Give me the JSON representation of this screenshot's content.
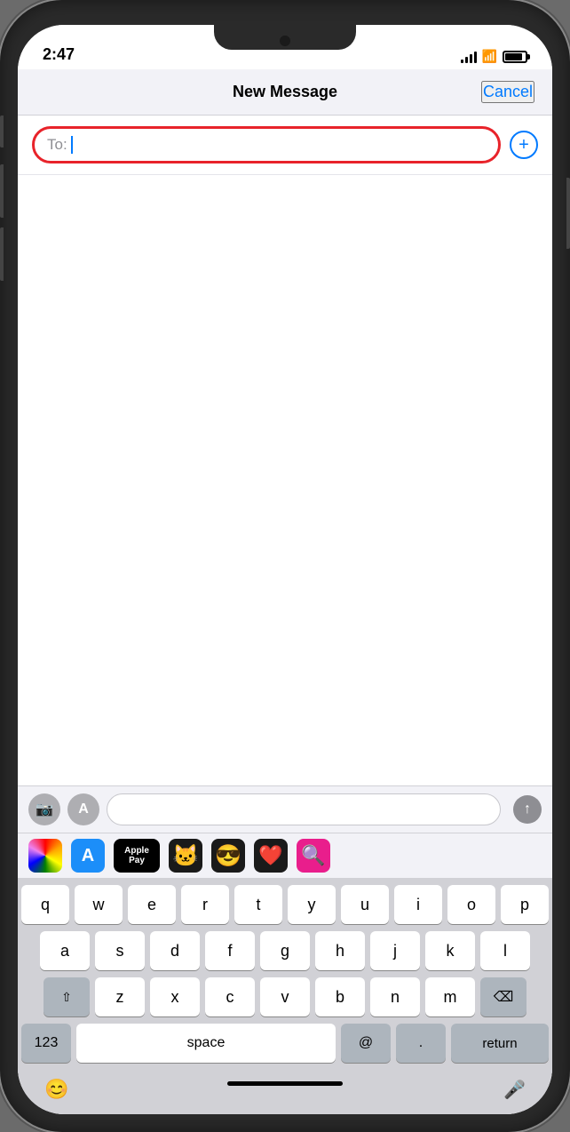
{
  "status": {
    "time": "2:47",
    "signal_bars": [
      4,
      7,
      10,
      13
    ],
    "battery_level": "80%"
  },
  "nav": {
    "title": "New Message",
    "cancel_label": "Cancel"
  },
  "to_field": {
    "label": "To:",
    "placeholder": ""
  },
  "app_strip": {
    "icons": [
      {
        "name": "photos",
        "emoji": "🌸",
        "bg": "#fff",
        "border": "1px solid #ddd"
      },
      {
        "name": "appstore",
        "emoji": "🅐",
        "bg": "#1c8ef9",
        "border": "none"
      },
      {
        "name": "applepay",
        "label": "Apple Pay",
        "bg": "#000",
        "border": "none"
      },
      {
        "name": "memoji1",
        "emoji": "🐱",
        "bg": "#222",
        "border": "none"
      },
      {
        "name": "memoji2",
        "emoji": "😎",
        "bg": "#222",
        "border": "none"
      },
      {
        "name": "hearts",
        "emoji": "❤️",
        "bg": "#111",
        "border": "none"
      },
      {
        "name": "search",
        "emoji": "🔍",
        "bg": "#e91e8c",
        "border": "none"
      }
    ]
  },
  "toolbar": {
    "camera_label": "📷",
    "appstore_label": "A",
    "send_label": "↑"
  },
  "keyboard": {
    "row1": [
      "q",
      "w",
      "e",
      "r",
      "t",
      "y",
      "u",
      "i",
      "o",
      "p"
    ],
    "row2": [
      "a",
      "s",
      "d",
      "f",
      "g",
      "h",
      "j",
      "k",
      "l"
    ],
    "row3": [
      "z",
      "x",
      "c",
      "v",
      "b",
      "n",
      "m"
    ],
    "special": {
      "shift": "⇧",
      "backspace": "⌫",
      "numbers": "123",
      "space": "space",
      "at": "@",
      "period": ".",
      "return": "return",
      "emoji": "😊",
      "mic": "🎤"
    }
  },
  "colors": {
    "accent": "#007aff",
    "red_ring": "#e8232a",
    "key_bg": "#ffffff",
    "special_key_bg": "#adb5bd",
    "keyboard_bg": "#d1d1d6",
    "nav_bg": "#f2f2f7"
  }
}
